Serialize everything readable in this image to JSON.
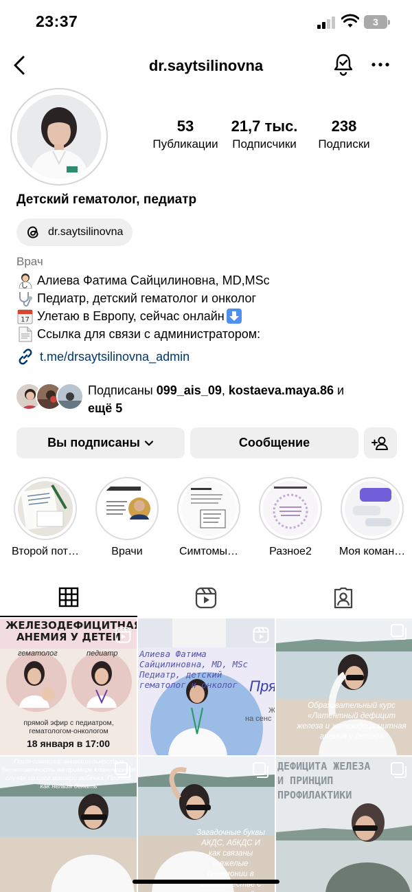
{
  "status_bar": {
    "time": "23:37",
    "battery": "3"
  },
  "header": {
    "username": "dr.saytsilinovna"
  },
  "profile": {
    "stats": [
      {
        "value": "53",
        "label": "Публикации"
      },
      {
        "value": "21,7 тыс.",
        "label": "Подписчики"
      },
      {
        "value": "238",
        "label": "Подписки"
      }
    ],
    "display_name": "Детский гематолог, педиатр",
    "threads_handle": "dr.saytsilinovna",
    "category": "Врач",
    "bio": [
      "Алиева Фатима Сайцилиновна, MD,MSc",
      "Педиатр, детский гематолог и онколог",
      "Улетаю в Европу, сейчас онлайн",
      "Ссылка для связи с администратором:"
    ],
    "link": "t.me/drsaytsilinovna_admin",
    "followed_by": {
      "prefix": "Подписаны ",
      "user1": "099_ais_09",
      "sep": ", ",
      "user2": "kostaeva.maya.86",
      "and": " и",
      "more": "ещё 5"
    }
  },
  "actions": {
    "following": "Вы подписаны",
    "message": "Сообщение"
  },
  "highlights": [
    {
      "label": "Второй пот…"
    },
    {
      "label": "Врачи"
    },
    {
      "label": "Симтомы…"
    },
    {
      "label": "Разное2"
    },
    {
      "label": "Моя коман…"
    }
  ],
  "posts": [
    {
      "title": "ЖЕЛЕЗОДЕФИЦИТНАЯ АНЕМИЯ У ДЕТЕЙ",
      "label_left": "гематолог",
      "label_right": "педиатр",
      "subtitle": "прямой эфир с педиатром, гематологом-онкологом",
      "date": "18 января в 17:00"
    },
    {
      "text": "Алиева Фатима Сайцилиновна, MD, MSc Педиатр, детский гематолог и онколог",
      "side": "Пря",
      "side2": "Ж",
      "side3": "на сенс"
    },
    {
      "text": "Образовательный курс «Латентный дефицит железа и железодефицитная анемия у детей»"
    },
    {
      "text": "Пост-памятка: внимательность и бесчеловечность на примере клинического случая со слов матери ребёнка. Про то, как нельзя делать"
    },
    {
      "text": "Загадочные буквы АКДС, АбКДС И как связаны тяжелые пневмонии в младенчестве с вакцинацией"
    },
    {
      "text": "ДЕФИЦИТА ЖЕЛЕЗА И ПРИНЦИП ПРОФИЛАКТИКИ"
    }
  ]
}
